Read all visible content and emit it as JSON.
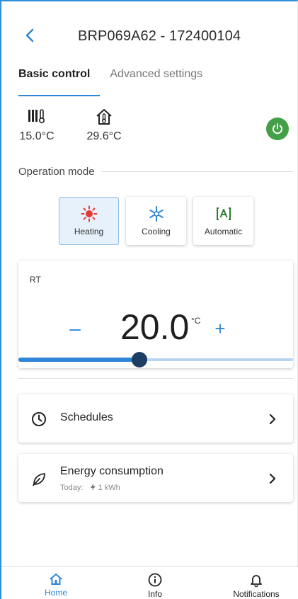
{
  "header": {
    "title": "BRP069A62 - 172400104"
  },
  "tabs": [
    {
      "label": "Basic control",
      "active": true
    },
    {
      "label": "Advanced settings",
      "active": false
    }
  ],
  "temperatures": {
    "outdoor": "15.0°C",
    "indoor": "29.6°C"
  },
  "power": {
    "state": "on",
    "color": "#43a047"
  },
  "operation_mode": {
    "label": "Operation mode",
    "modes": [
      {
        "label": "Heating",
        "icon": "sun-icon",
        "selected": true
      },
      {
        "label": "Cooling",
        "icon": "snowflake-icon",
        "selected": false
      },
      {
        "label": "Automatic",
        "icon": "auto-icon",
        "selected": false
      }
    ]
  },
  "rt": {
    "label": "RT",
    "minus": "–",
    "plus": "+",
    "setpoint": "20.0",
    "unit": "°C",
    "slider_fraction": 0.44
  },
  "schedules": {
    "label": "Schedules"
  },
  "energy": {
    "label": "Energy consumption",
    "today_label": "Today:",
    "today_value": "1 kWh"
  },
  "nav": [
    {
      "label": "Home",
      "icon": "home-icon",
      "active": true
    },
    {
      "label": "Info",
      "icon": "info-icon",
      "active": false
    },
    {
      "label": "Notifications",
      "icon": "bell-icon",
      "active": false
    }
  ],
  "colors": {
    "accent": "#2f86d6",
    "power": "#43a047",
    "heating": "#e53935",
    "cooling": "#2f86d6",
    "auto": "#2e7d32"
  }
}
